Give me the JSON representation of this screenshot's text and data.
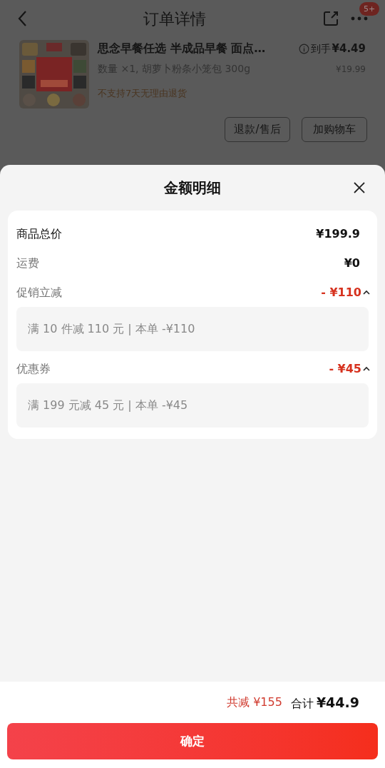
{
  "nav": {
    "title": "订单详情",
    "badge": "5+"
  },
  "product": {
    "kind": "picture",
    "title": "思念早餐任选 半成品早餐 面点…",
    "spec": "数量 ×1, 胡萝卜粉条小笼包 300g",
    "notice": "不支持7天无理由退货",
    "final_label": "到手",
    "final_price": "¥4.49",
    "price": "¥19.99",
    "buttons": [
      "退款/售后",
      "加购物车"
    ]
  },
  "sheet": {
    "title": "金额明细",
    "rows": [
      {
        "kind": "total",
        "label": "商品总价",
        "value": "¥199.9"
      },
      {
        "kind": "plain",
        "label": "运费",
        "value": "¥0"
      },
      {
        "kind": "discount",
        "label": "促销立减",
        "value": "- ¥110",
        "expanded": true,
        "detail": "满 10 件减 110 元 | 本单 -¥110"
      },
      {
        "kind": "discount",
        "label": "优惠券",
        "value": "- ¥45",
        "expanded": true,
        "detail": "满 199 元减 45 元 | 本单 -¥45"
      }
    ],
    "saved": "共减 ¥155",
    "total_label": "合计",
    "total": "¥44.9",
    "confirm": "确定"
  }
}
